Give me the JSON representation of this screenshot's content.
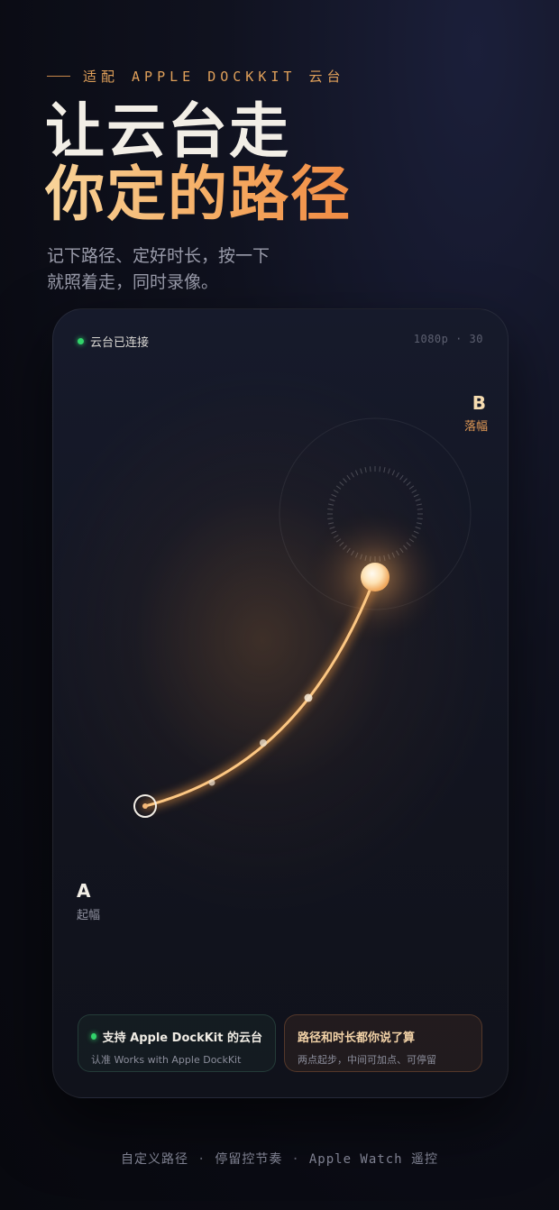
{
  "eyebrow": "适配 APPLE DOCKKIT 云台",
  "headline": {
    "line1": "让云台走",
    "line2": "你定的路径"
  },
  "subtitle": "记下路径、定好时长，按一下就照着走，同时录像。",
  "card": {
    "status": "云台已连接",
    "resolution": "1080p · 30",
    "point_b": {
      "letter": "B",
      "label": "落幅"
    },
    "point_a": {
      "letter": "A",
      "label": "起幅"
    },
    "pill_left": {
      "title": "支持 Apple DockKit 的云台",
      "subtitle": "认准 Works with Apple DockKit"
    },
    "pill_right": {
      "title": "路径和时长都你说了算",
      "subtitle": "两点起步，中间可加点、可停留"
    }
  },
  "footer": {
    "item1": "自定义路径",
    "item2": "停留控节奏",
    "item3": "Apple Watch 遥控"
  },
  "colors": {
    "accent": "#f5ad64",
    "connected": "#32d46b"
  }
}
